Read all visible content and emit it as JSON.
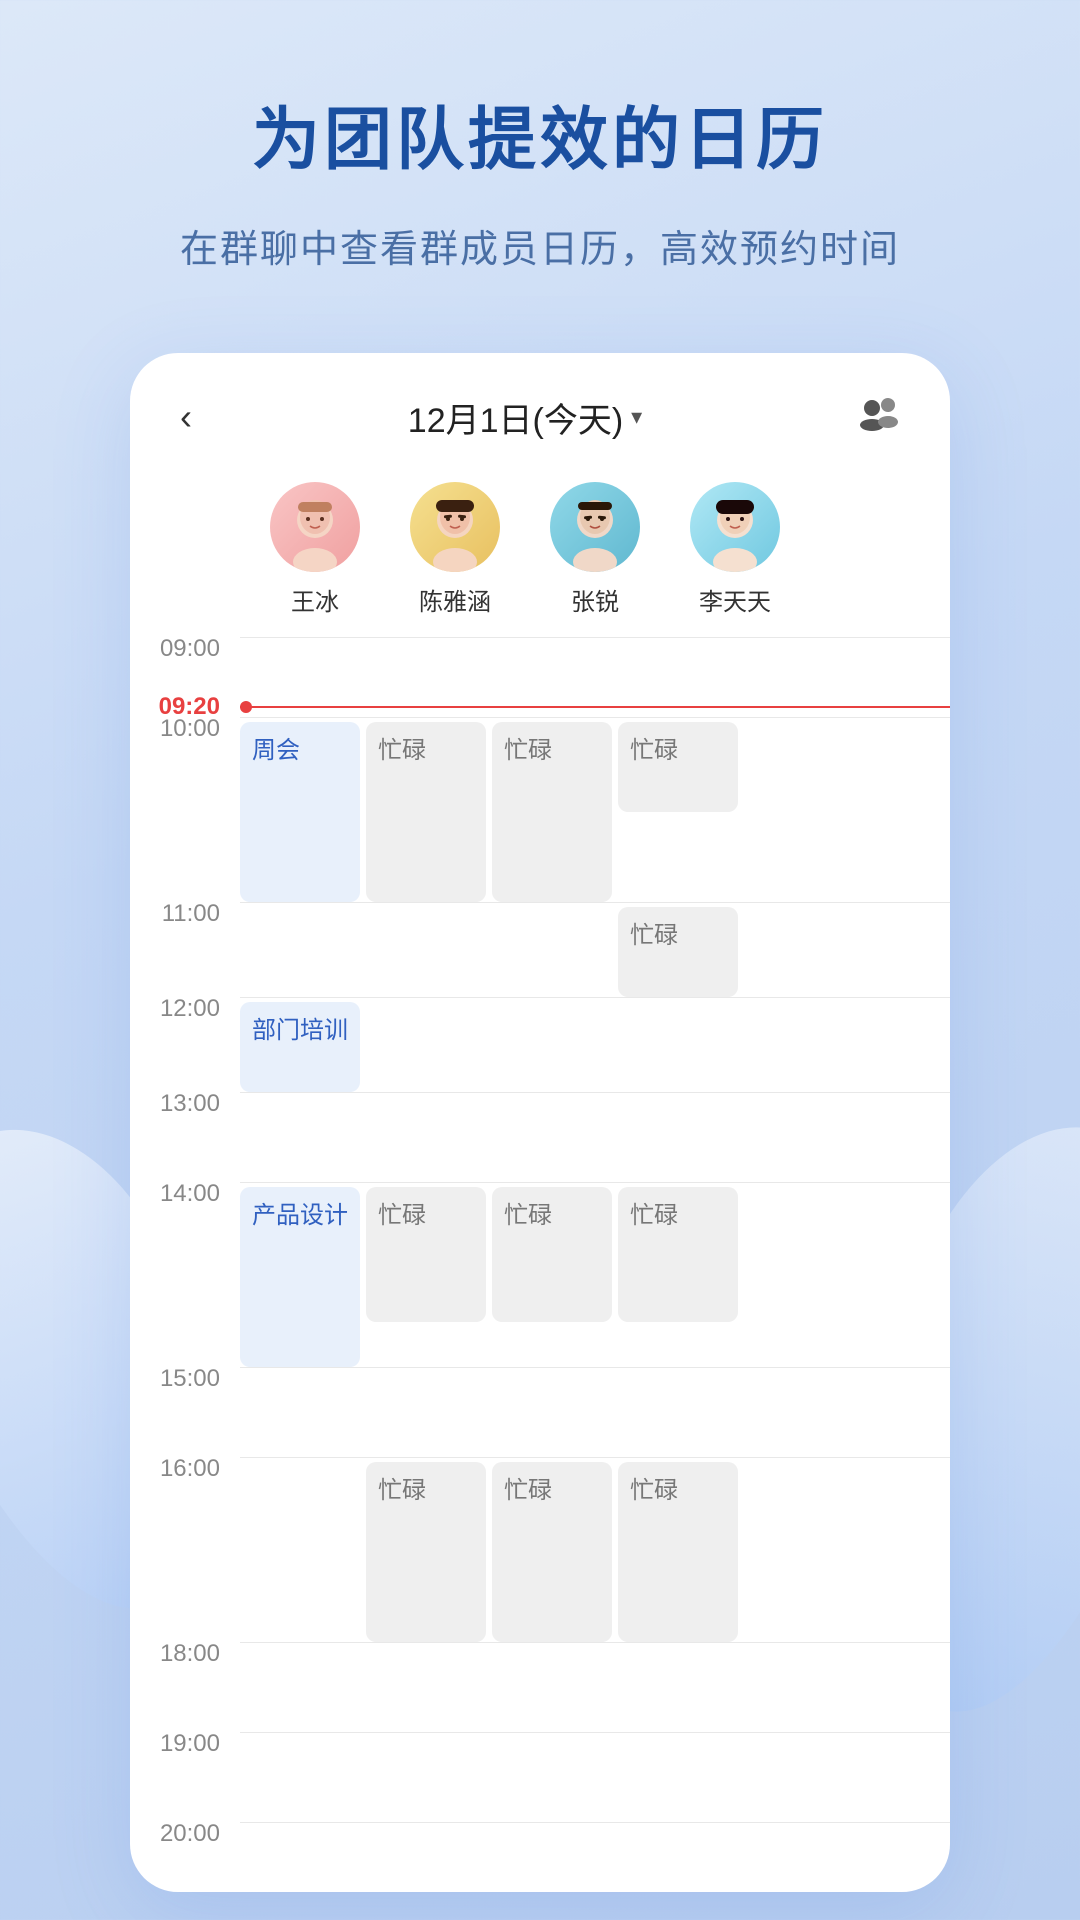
{
  "headline": "为团队提效的日历",
  "subtitle": "在群聊中查看群成员日历，高效预约时间",
  "header": {
    "back_label": "‹",
    "date_label": "12月1日(今天)",
    "date_arrow": "▾",
    "group_icon": "👥"
  },
  "avatars": [
    {
      "id": "wang",
      "name": "王冰",
      "emoji": "👩",
      "bg": "wang"
    },
    {
      "id": "chen",
      "name": "陈雅涵",
      "emoji": "👩",
      "bg": "chen"
    },
    {
      "id": "zhang",
      "name": "张锐",
      "emoji": "👨",
      "bg": "zhang"
    },
    {
      "id": "li",
      "name": "李天天",
      "emoji": "👩",
      "bg": "li"
    }
  ],
  "times": [
    "09:00",
    "09:20",
    "10:00",
    "11:00",
    "12:00",
    "13:00",
    "14:00",
    "15:00",
    "16:00",
    "18:00",
    "19:00",
    "20:00"
  ],
  "events": {
    "zhouhui_label": "周会",
    "bumenpeixun_label": "部门培训",
    "chanpinsheji_label": "产品设计",
    "mangle_label": "忙碌"
  }
}
